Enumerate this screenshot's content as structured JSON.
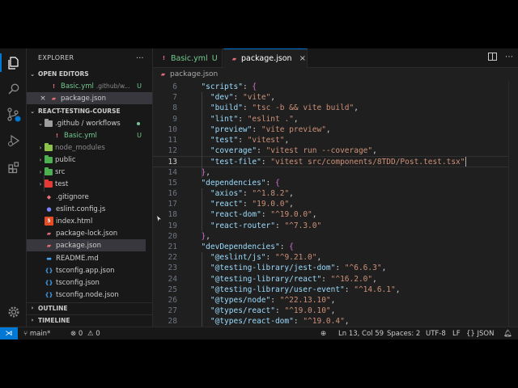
{
  "colors": {
    "accent": "#0078d4",
    "git_added": "#73c991",
    "string": "#ce9178",
    "key": "#9cdcfe"
  },
  "activity_bar": [
    "files-icon",
    "search-icon",
    "source-control-icon",
    "run-debug-icon",
    "extensions-icon",
    "settings-gear-icon"
  ],
  "sidebar": {
    "title": "EXPLORER",
    "more": "...",
    "open_editors": {
      "label": "OPEN EDITORS",
      "items": [
        {
          "name": "Basic.yml",
          "path": ".github/w...",
          "badge": "U"
        },
        {
          "name": "package.json",
          "close": "×"
        }
      ]
    },
    "project": {
      "label": "REACT-TESTING-COURSE",
      "tree": [
        {
          "name": ".github / workflows",
          "type": "folder-open"
        },
        {
          "name": "Basic.yml",
          "badge": "U"
        },
        {
          "name": "node_modules",
          "type": "folder"
        },
        {
          "name": "public",
          "type": "folder"
        },
        {
          "name": "src",
          "type": "folder"
        },
        {
          "name": "test",
          "type": "folder"
        },
        {
          "name": ".gitignore"
        },
        {
          "name": "eslint.config.js"
        },
        {
          "name": "index.html"
        },
        {
          "name": "package-lock.json"
        },
        {
          "name": "package.json"
        },
        {
          "name": "README.md"
        },
        {
          "name": "tsconfig.app.json"
        },
        {
          "name": "tsconfig.json"
        },
        {
          "name": "tsconfig.node.json"
        }
      ]
    },
    "outline_label": "OUTLINE",
    "timeline_label": "TIMELINE"
  },
  "tabs": [
    {
      "label": "Basic.yml",
      "badge": "U"
    },
    {
      "label": "package.json",
      "close": "×"
    }
  ],
  "breadcrumb": "package.json",
  "editor": {
    "lines": [
      {
        "n": "6",
        "text": "  \"scripts\": {"
      },
      {
        "n": "7",
        "text": "    \"dev\": \"vite\","
      },
      {
        "n": "8",
        "text": "    \"build\": \"tsc -b && vite build\","
      },
      {
        "n": "9",
        "text": "    \"lint\": \"eslint .\","
      },
      {
        "n": "10",
        "text": "    \"preview\": \"vite preview\","
      },
      {
        "n": "11",
        "text": "    \"test\": \"vitest\","
      },
      {
        "n": "12",
        "text": "    \"coverage\": \"vitest run --coverage\","
      },
      {
        "n": "13",
        "text": "    \"test-file\": \"vitest src/components/8TDD/Post.test.tsx\""
      },
      {
        "n": "14",
        "text": "  },"
      },
      {
        "n": "15",
        "text": "  \"dependencies\": {"
      },
      {
        "n": "16",
        "text": "    \"axios\": \"^1.8.2\","
      },
      {
        "n": "17",
        "text": "    \"react\": \"19.0.0\","
      },
      {
        "n": "18",
        "text": "    \"react-dom\": \"^19.0.0\","
      },
      {
        "n": "19",
        "text": "    \"react-router\": \"^7.3.0\""
      },
      {
        "n": "20",
        "text": "  },"
      },
      {
        "n": "21",
        "text": "  \"devDependencies\": {"
      },
      {
        "n": "22",
        "text": "    \"@eslint/js\": \"^9.21.0\","
      },
      {
        "n": "23",
        "text": "    \"@testing-library/jest-dom\": \"^6.6.3\","
      },
      {
        "n": "24",
        "text": "    \"@testing-library/react\": \"^16.2.0\","
      },
      {
        "n": "25",
        "text": "    \"@testing-library/user-event\": \"^14.6.1\","
      },
      {
        "n": "26",
        "text": "    \"@types/node\": \"^22.13.10\","
      },
      {
        "n": "27",
        "text": "    \"@types/react\": \"^19.0.10\","
      },
      {
        "n": "28",
        "text": "    \"@types/react-dom\": \"^19.0.4\","
      }
    ],
    "current_line": "13"
  },
  "status": {
    "branch": "main*",
    "errors": "0",
    "warnings": "0",
    "position": "Ln 13, Col 59",
    "spaces": "Spaces: 2",
    "encoding": "UTF-8",
    "eol": "LF",
    "language": "JSON"
  }
}
